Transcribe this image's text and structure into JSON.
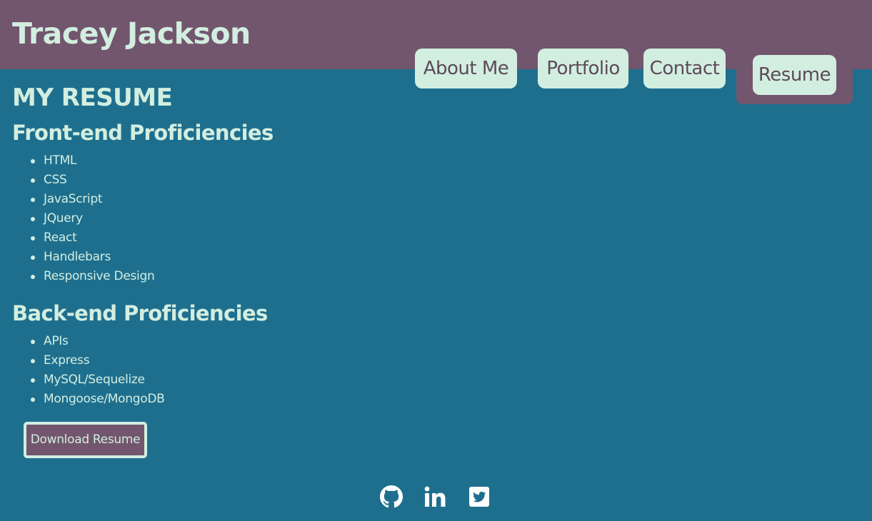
{
  "header": {
    "site_title": "Tracey Jackson"
  },
  "nav": {
    "about": "About Me",
    "portfolio": "Portfolio",
    "contact": "Contact",
    "resume": "Resume"
  },
  "main": {
    "heading": "MY RESUME",
    "front_end": {
      "heading": "Front-end Proficiencies",
      "items": [
        "HTML",
        "CSS",
        "JavaScript",
        "JQuery",
        "React",
        "Handlebars",
        "Responsive Design"
      ]
    },
    "back_end": {
      "heading": "Back-end Proficiencies",
      "items": [
        "APIs",
        "Express",
        "MySQL/Sequelize",
        "Mongoose/MongoDB"
      ]
    },
    "download_label": "Download Resume"
  },
  "footer": {
    "icons": [
      "github-icon",
      "linkedin-icon",
      "twitter-icon"
    ]
  },
  "colors": {
    "background": "#1e6f8e",
    "header": "#72566e",
    "accent": "#d2eee0",
    "nav_text": "#5d4a5b"
  }
}
